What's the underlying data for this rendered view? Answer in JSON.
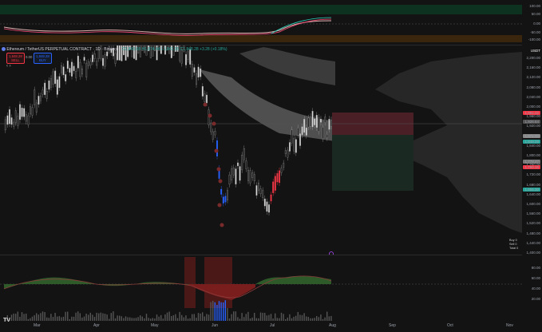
{
  "symbol_title": "Ethereum / TetherUS PERPETUAL CONTRACT · 1D · Binance",
  "ohlc_readout": "O1,843.68 H1,874.44 L1,843.35 C1,848.28 +3.28 (+0.18%)",
  "indicator_readout": "MA 100  2,013.58",
  "sell": {
    "price": "1,848.28",
    "label": "SELL"
  },
  "buy": {
    "price": "1,848.28",
    "label": "BUY"
  },
  "qty": "0.00",
  "currency": "USDT",
  "oscillator_ticks": [
    "100.00",
    "50.00",
    "0.00",
    "-50.00",
    "-100.00"
  ],
  "price_ticks": [
    "2,200.00",
    "2,160.00",
    "2,120.00",
    "2,080.00",
    "2,040.00",
    "2,000.00",
    "1,960.00",
    "1,920.00",
    "1,880.00",
    "1,840.00",
    "1,800.00",
    "1,760.00",
    "1,720.00",
    "1,680.00",
    "1,640.00",
    "1,600.00",
    "1,560.00",
    "1,520.00",
    "1,480.00",
    "1,440.00",
    "1,400.00"
  ],
  "price_tags": {
    "stop": "1,961.22",
    "last": "1,926.64",
    "entry": "1,871.00",
    "current": "1,848.28",
    "level1": "1,778.47",
    "level2": "1,760.15",
    "target": "1,655.30"
  },
  "legend": {
    "row1": "Buy",
    "row2": "Sell",
    "row3": "Total",
    "v1": "0",
    "v2": "0",
    "v3": "0"
  },
  "lower_ticks": [
    "80.00",
    "60.00",
    "40.00",
    "20.00"
  ],
  "months": [
    "Mar",
    "Apr",
    "May",
    "Jun",
    "Jul",
    "Aug",
    "Sep",
    "Oct",
    "Nov"
  ],
  "logo": "TV",
  "colors": {
    "bull": "#d9d9d9",
    "bear": "#1e1e1e",
    "blue": "#2962ff",
    "red": "#f23645",
    "green": "#26a69a"
  }
}
